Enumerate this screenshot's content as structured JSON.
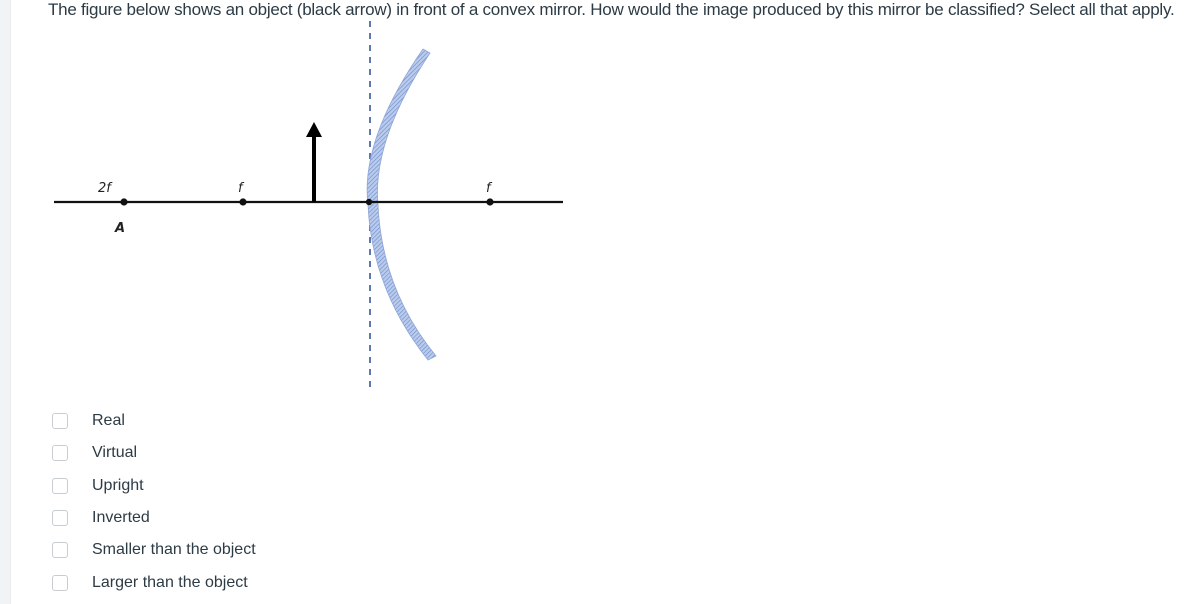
{
  "question": {
    "text": "The figure below shows an object (black arrow) in front of a convex mirror. How would the image produced by this mirror be classified? Select all that apply.",
    "type": "multiple-select"
  },
  "figure": {
    "description": "Convex mirror ray diagram with principal axis, object arrow, and focal points",
    "labels": {
      "two_f": "2f",
      "point_a": "A",
      "f_left": "f",
      "f_right": "f"
    },
    "object": "black arrow (upright)",
    "mirror_type": "convex",
    "colors": {
      "axis": "#111111",
      "object_arrow": "#000000",
      "mirror_fill": "#a9bfe6",
      "mirror_hatch": "#6f8cc4",
      "dashed_line": "#5b78b0"
    }
  },
  "options": [
    {
      "label": "Real",
      "checked": false
    },
    {
      "label": "Virtual",
      "checked": false
    },
    {
      "label": "Upright",
      "checked": false
    },
    {
      "label": "Inverted",
      "checked": false
    },
    {
      "label": "Smaller than the object",
      "checked": false
    },
    {
      "label": "Larger than the object",
      "checked": false
    }
  ]
}
